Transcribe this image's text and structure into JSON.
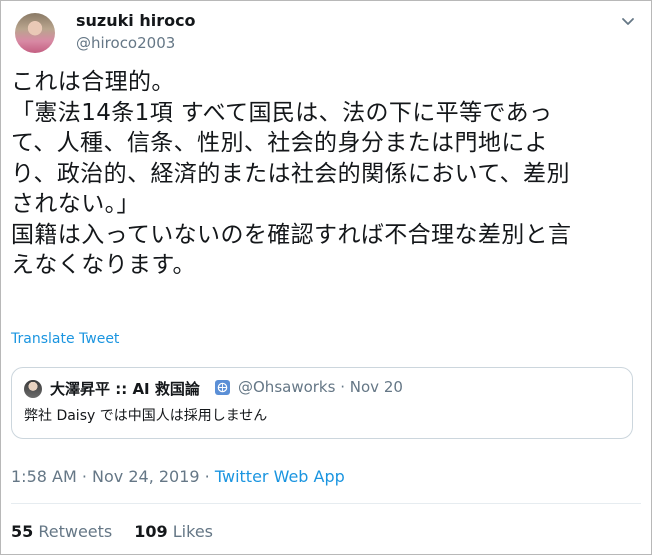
{
  "author": {
    "display_name": "suzuki hiroco",
    "handle": "@hiroco2003"
  },
  "tweet": {
    "text": "これは合理的。\n「憲法14条1項 すべて国民は、法の下に平等であっ\nて、人種、信条、性別、社会的身分または門地によ\nり、政治的、経済的または社会的関係において、差別\nされない。」\n国籍は入っていないのを確認すれば不合理な差別と言\nえなくなります。",
    "translate_label": "Translate Tweet"
  },
  "quoted_tweet": {
    "display_name": "大澤昇平 :: AI 救国論",
    "handle": "@Ohsaworks",
    "separator": "·",
    "date": "Nov 20",
    "text": "弊社 Daisy では中国人は採用しません"
  },
  "meta": {
    "time": "1:58 AM",
    "sep1": " · ",
    "date": "Nov 24, 2019",
    "sep2": " · ",
    "source": "Twitter Web App"
  },
  "stats": {
    "retweets_count": "55",
    "retweets_label": "Retweets",
    "likes_count": "109",
    "likes_label": "Likes"
  },
  "icons": {
    "caret": "chevron-down-icon",
    "badge": "verified-like-badge-icon"
  },
  "colors": {
    "link": "#1b95e0",
    "secondary_text": "#657786",
    "primary_text": "#14171a",
    "border": "#ccd6dd"
  }
}
